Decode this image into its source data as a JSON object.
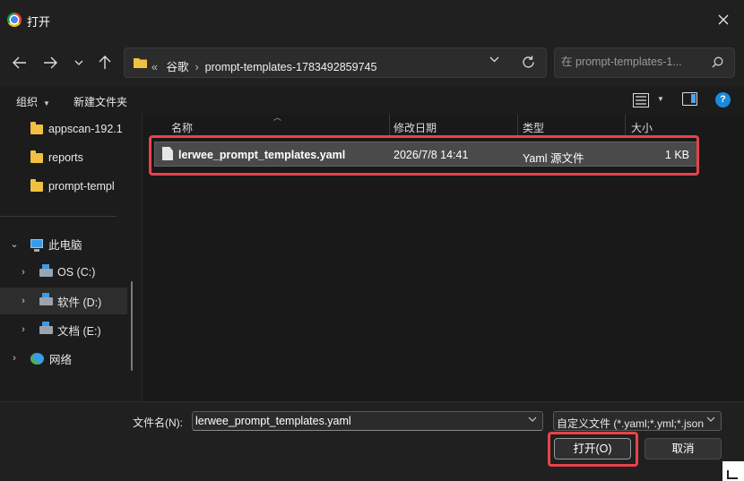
{
  "window": {
    "title": "打开"
  },
  "nav": {
    "breadcrumb": {
      "overflow": "«",
      "items": [
        "谷歌",
        "prompt-templates-1783492859745"
      ]
    },
    "search_placeholder": "在 prompt-templates-1..."
  },
  "toolbar": {
    "organize": "组织",
    "new_folder": "新建文件夹"
  },
  "sidebar": {
    "items": [
      {
        "label": "appscan-192.1",
        "type": "folder"
      },
      {
        "label": "reports",
        "type": "folder"
      },
      {
        "label": "prompt-templ",
        "type": "folder"
      },
      {
        "label": "此电脑",
        "type": "pc"
      },
      {
        "label": "OS (C:)",
        "type": "drive"
      },
      {
        "label": "软件 (D:)",
        "type": "drive"
      },
      {
        "label": "文档 (E:)",
        "type": "drive"
      },
      {
        "label": "网络",
        "type": "network"
      }
    ]
  },
  "list": {
    "columns": [
      "名称",
      "修改日期",
      "类型",
      "大小"
    ],
    "rows": [
      {
        "name": "lerwee_prompt_templates.yaml",
        "date": "2026/7/8 14:41",
        "type": "Yaml 源文件",
        "size": "1 KB"
      }
    ]
  },
  "footer": {
    "filename_label": "文件名(N):",
    "filename_value": "lerwee_prompt_templates.yaml",
    "filetype_value": "自定义文件 (*.yaml;*.yml;*.json)",
    "open_label": "打开(O)",
    "cancel_label": "取消"
  },
  "colors": {
    "highlight": "#e8434a",
    "accent": "#1a8ad8",
    "folder": "#f0c040"
  }
}
